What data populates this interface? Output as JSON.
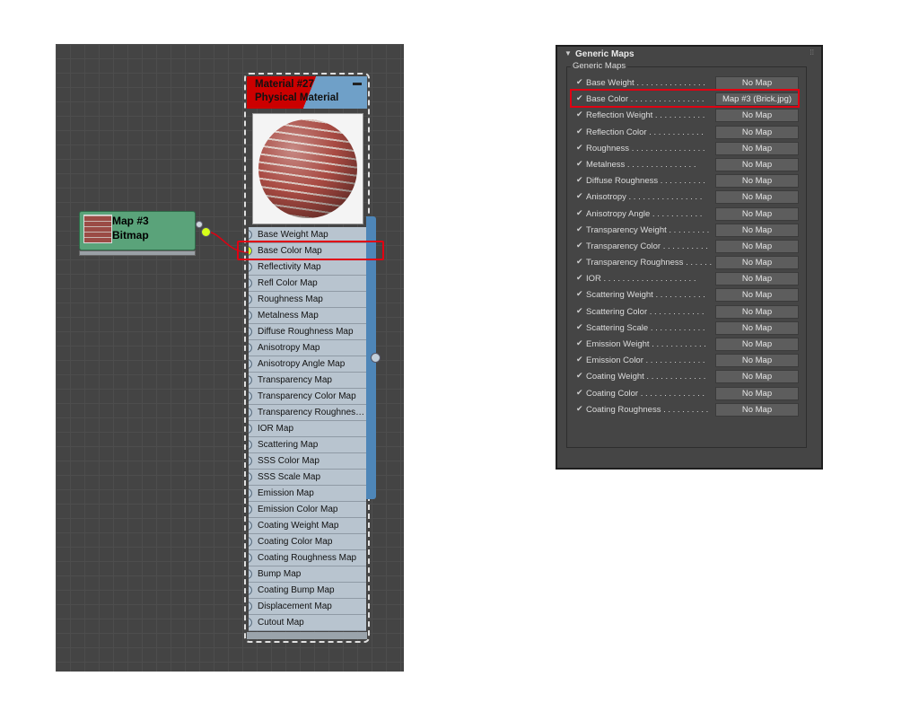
{
  "slate": {
    "bitmap_node": {
      "title": "Map #3",
      "subtitle": "Bitmap"
    },
    "material_node": {
      "title": "Material #27",
      "subtitle": "Physical Material",
      "minimize": "▬",
      "slots": [
        {
          "label": "Base Weight Map",
          "connected": false
        },
        {
          "label": "Base Color Map",
          "connected": true
        },
        {
          "label": "Reflectivity Map",
          "connected": false
        },
        {
          "label": "Refl Color Map",
          "connected": false
        },
        {
          "label": "Roughness Map",
          "connected": false
        },
        {
          "label": "Metalness Map",
          "connected": false
        },
        {
          "label": "Diffuse Roughness Map",
          "connected": false
        },
        {
          "label": "Anisotropy Map",
          "connected": false
        },
        {
          "label": "Anisotropy Angle Map",
          "connected": false
        },
        {
          "label": "Transparency Map",
          "connected": false
        },
        {
          "label": "Transparency Color Map",
          "connected": false
        },
        {
          "label": "Transparency Roughness Map",
          "connected": false
        },
        {
          "label": "IOR Map",
          "connected": false
        },
        {
          "label": "Scattering Map",
          "connected": false
        },
        {
          "label": "SSS Color Map",
          "connected": false
        },
        {
          "label": "SSS Scale Map",
          "connected": false
        },
        {
          "label": "Emission Map",
          "connected": false
        },
        {
          "label": "Emission Color Map",
          "connected": false
        },
        {
          "label": "Coating Weight Map",
          "connected": false
        },
        {
          "label": "Coating Color Map",
          "connected": false
        },
        {
          "label": "Coating Roughness Map",
          "connected": false
        },
        {
          "label": "Bump Map",
          "connected": false
        },
        {
          "label": "Coating Bump Map",
          "connected": false
        },
        {
          "label": "Displacement Map",
          "connected": false
        },
        {
          "label": "Cutout Map",
          "connected": false
        }
      ]
    }
  },
  "panel": {
    "rollout_title": "Generic Maps",
    "group_label": "Generic Maps",
    "check_glyph": "✔",
    "rows": [
      {
        "label": "Base Weight . . . . . . . . . . . . . . .",
        "button": "No Map"
      },
      {
        "label": "Base Color . . . . . . . . . . . . . . . .",
        "button": "Map #3 (Brick.jpg)"
      },
      {
        "label": "Reflection Weight . . . . . . . . . . .",
        "button": "No Map"
      },
      {
        "label": "Reflection Color . . . . . . . . . . . .",
        "button": "No Map"
      },
      {
        "label": "Roughness . . . . . . . . . . . . . . . .",
        "button": "No Map"
      },
      {
        "label": "Metalness . . . . . . . . . . . . . . .",
        "button": "No Map"
      },
      {
        "label": "Diffuse Roughness . . . . . . . . . .",
        "button": "No Map"
      },
      {
        "label": "Anisotropy . . . . . . . . . . . . . . . .",
        "button": "No Map"
      },
      {
        "label": "Anisotropy Angle . . . . . . . . . . .",
        "button": "No Map"
      },
      {
        "label": "Transparency Weight . . . . . . . . .",
        "button": "No Map"
      },
      {
        "label": "Transparency Color . . . . . . . . . .",
        "button": "No Map"
      },
      {
        "label": "Transparency Roughness . . . . . .",
        "button": "No Map"
      },
      {
        "label": "IOR . . . . . . . . . . . . . . . . . . . .",
        "button": "No Map"
      },
      {
        "label": "Scattering Weight . . . . . . . . . . .",
        "button": "No Map"
      },
      {
        "label": "Scattering Color . . . . . . . . . . . .",
        "button": "No Map"
      },
      {
        "label": "Scattering Scale . . . . . . . . . . . .",
        "button": "No Map"
      },
      {
        "label": "Emission Weight . . . . . . . . . . . .",
        "button": "No Map"
      },
      {
        "label": "Emission Color . . . . . . . . . . . . .",
        "button": "No Map"
      },
      {
        "label": "Coating Weight . . . . . . . . . . . . .",
        "button": "No Map"
      },
      {
        "label": "Coating Color . . . . . . . . . . . . . .",
        "button": "No Map"
      },
      {
        "label": "Coating Roughness . . . . . . . . . .",
        "button": "No Map"
      }
    ]
  }
}
